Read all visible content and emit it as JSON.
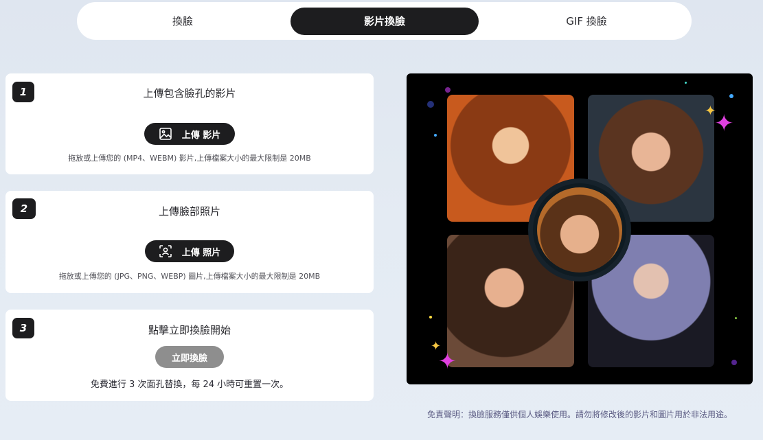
{
  "tabs": [
    {
      "label": "換臉"
    },
    {
      "label": "影片換臉"
    },
    {
      "label": "GIF 換臉"
    }
  ],
  "steps": [
    {
      "number": "1",
      "title": "上傳包含臉孔的影片",
      "button": "上傳 影片",
      "icon": "image-icon",
      "hint": "拖放或上傳您的 (MP4、WEBM) 影片,上傳檔案大小的最大限制是 20MB"
    },
    {
      "number": "2",
      "title": "上傳臉部照片",
      "button": "上傳 照片",
      "icon": "face-scan-icon",
      "hint": "拖放或上傳您的 (JPG、PNG、WEBP) 圖片,上傳檔案大小的最大限制是 20MB"
    },
    {
      "number": "3",
      "title": "點擊立即換臉開始",
      "button": "立即換臉",
      "hint": "免費進行 3 次面孔替換，每 24 小時可重置一次。"
    }
  ],
  "disclaimer": "免責聲明：換臉服務僅供個人娛樂使用。請勿將修改後的影片和圖片用於非法用途。",
  "colors": {
    "active_tab": "#1d1d1f",
    "disabled_button": "#8e8e8e",
    "sparkle_pink": "#e040e0",
    "sparkle_yellow": "#f5c542"
  }
}
